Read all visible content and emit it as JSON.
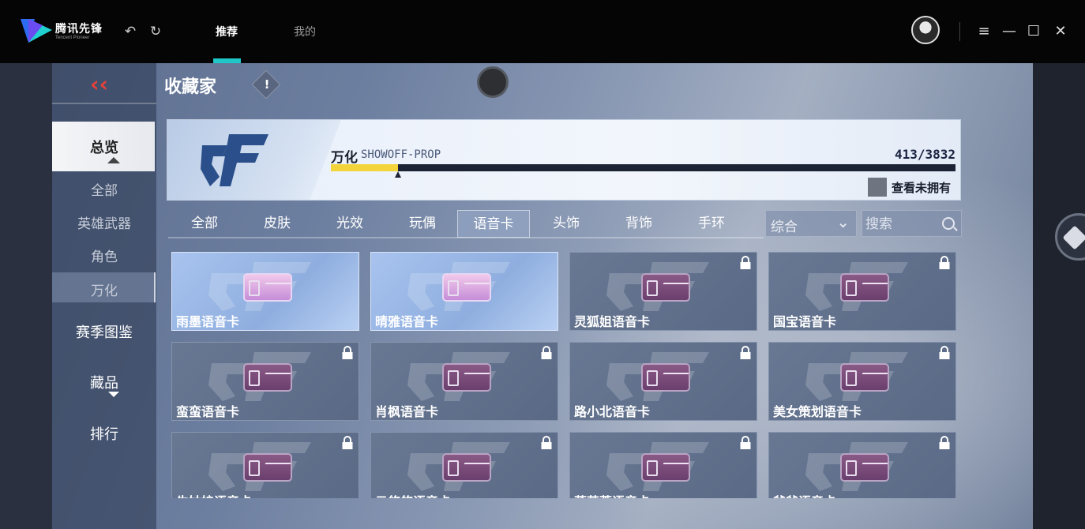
{
  "app": {
    "brand_name": "腾讯先锋",
    "brand_sub": "Tencent Pioneer",
    "tabs": [
      {
        "label": "推荐",
        "active": true
      },
      {
        "label": "我的",
        "active": false
      }
    ]
  },
  "game": {
    "page_title": "收藏家",
    "sidebar": {
      "items": [
        {
          "label": "总览",
          "active": true
        },
        {
          "label": "全部"
        },
        {
          "label": "英雄武器"
        },
        {
          "label": "角色"
        },
        {
          "label": "万化",
          "active": true
        },
        {
          "label": "赛季图鉴"
        },
        {
          "label": "藏品"
        },
        {
          "label": "排行"
        }
      ]
    },
    "banner": {
      "name": "万化",
      "sub": "SHOWOFF-PROP",
      "count": "413/3832",
      "progress": 0.108,
      "toggle_label": "查看未拥有"
    },
    "filters": [
      "全部",
      "皮肤",
      "光效",
      "玩偶",
      "语音卡",
      "头饰",
      "背饰",
      "手环"
    ],
    "active_filter": "语音卡",
    "sort": {
      "label": "综合"
    },
    "search": {
      "placeholder": "搜索"
    },
    "cards": [
      {
        "name": "雨墨语音卡",
        "owned": true
      },
      {
        "name": "晴雅语音卡",
        "owned": true
      },
      {
        "name": "灵狐姐语音卡",
        "owned": false
      },
      {
        "name": "国宝语音卡",
        "owned": false
      },
      {
        "name": "蛮蛮语音卡",
        "owned": false
      },
      {
        "name": "肖枫语音卡",
        "owned": false
      },
      {
        "name": "路小北语音卡",
        "owned": false
      },
      {
        "name": "美女策划语音卡",
        "owned": false
      },
      {
        "name": "牛姑娘语音卡",
        "owned": false
      },
      {
        "name": "云悠悠语音卡",
        "owned": false
      },
      {
        "name": "落芙蓉语音卡",
        "owned": false
      },
      {
        "name": "爷爷语音卡",
        "owned": false
      }
    ]
  },
  "colors": {
    "accent": "#1fc7c7",
    "back_red": "#e8413a",
    "progress_fill": "#f3d53b"
  }
}
